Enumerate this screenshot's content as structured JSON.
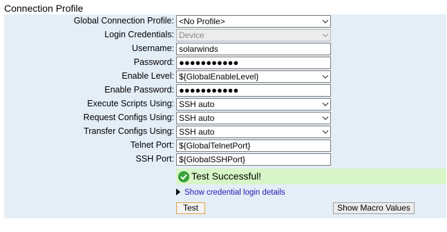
{
  "section_title": "Connection Profile",
  "rows": [
    {
      "label": "Global Connection Profile:",
      "value": "<No Profile>",
      "type": "select"
    },
    {
      "label": "Login Credentials:",
      "value": "Device",
      "type": "select-disabled"
    },
    {
      "label": "Username:",
      "value": "solarwinds",
      "type": "text"
    },
    {
      "label": "Password:",
      "value": "●●●●●●●●●●●",
      "type": "password"
    },
    {
      "label": "Enable Level:",
      "value": "${GlobalEnableLevel}",
      "type": "select"
    },
    {
      "label": "Enable Password:",
      "value": "●●●●●●●●●●●",
      "type": "password"
    },
    {
      "label": "Execute Scripts Using:",
      "value": "SSH auto",
      "type": "select"
    },
    {
      "label": "Request Configs Using:",
      "value": "SSH auto",
      "type": "select"
    },
    {
      "label": "Transfer Configs Using:",
      "value": "SSH auto",
      "type": "select"
    },
    {
      "label": "Telnet Port:",
      "value": "${GlobalTelnetPort}",
      "type": "text"
    },
    {
      "label": "SSH Port:",
      "value": "${GlobalSSHPort}",
      "type": "text"
    }
  ],
  "status": {
    "text": "Test Successful!",
    "color": "#d8f5c7",
    "icon": "check-circle-icon"
  },
  "details_link": "Show credential login details",
  "buttons": {
    "test": "Test",
    "macro": "Show Macro Values"
  }
}
